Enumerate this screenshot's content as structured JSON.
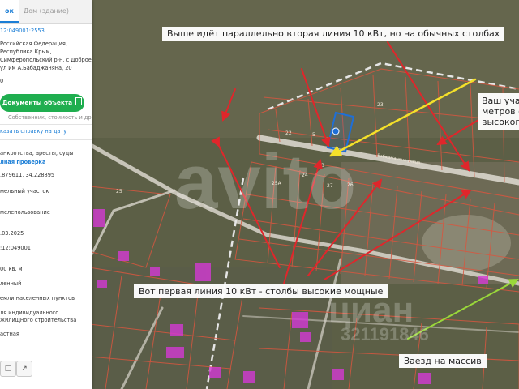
{
  "panel": {
    "tab_active": "ок",
    "tab_inactive": "Дом (здание)",
    "cadastral_number": "12:049001:2553",
    "address_line1": "Российская Федерация,",
    "address_line2": "Республика Крым,",
    "address_line3": "Симферопольский р-н, с Доброе ,",
    "address_line4": "ул им А.Бабаджаняна, 20",
    "field_left": "0",
    "documents_button": "Документы объекта",
    "documents_caption": "Собственник, стоимость и др.",
    "order_link": "казать справку на дату",
    "risk_line1": "анкротства, аресты, суды",
    "risk_line2": "лная проверка",
    "coordinates": ".879611, 34.228895",
    "category": "мельный участок",
    "usage": "мелепользование",
    "date": ".03.2025",
    "parent_number": ":12:049001",
    "area": "00 кв. м",
    "status": "ленный",
    "land_category": "емли населенных пунктов",
    "purpose_line1": "ля индивидуального",
    "purpose_line2": "жилищного строительства",
    "ownership": "астная"
  },
  "notes": {
    "top": "Выше идёт параллельно вторая линия 10 кВт, но на обычных  столбах",
    "right_line1": "Ваш уча",
    "right_line2": "метров о",
    "right_line3": "высоког",
    "bottom": "Вот первая линия 10 кВт - столбы высокие мощные",
    "entrance": "Заезд на массив"
  },
  "plot_numbers": [
    "22",
    "23",
    "24",
    "26",
    "27",
    "25А",
    "25",
    "3",
    "5"
  ],
  "street_label": "Бабаджаняна улица",
  "watermark_top": "avito",
  "watermark_bottom": "циан",
  "watermark_id": "321191846",
  "colors": {
    "arrow_red": "#e0262b",
    "arrow_yellow": "#f4e02a",
    "arrow_green": "#9ad83a",
    "parcel_line": "#d8563f",
    "road": "#d9d6cc",
    "highlight": "#1f6fd6",
    "button_green": "#1fae4f",
    "link_blue": "#1b7ed6"
  }
}
